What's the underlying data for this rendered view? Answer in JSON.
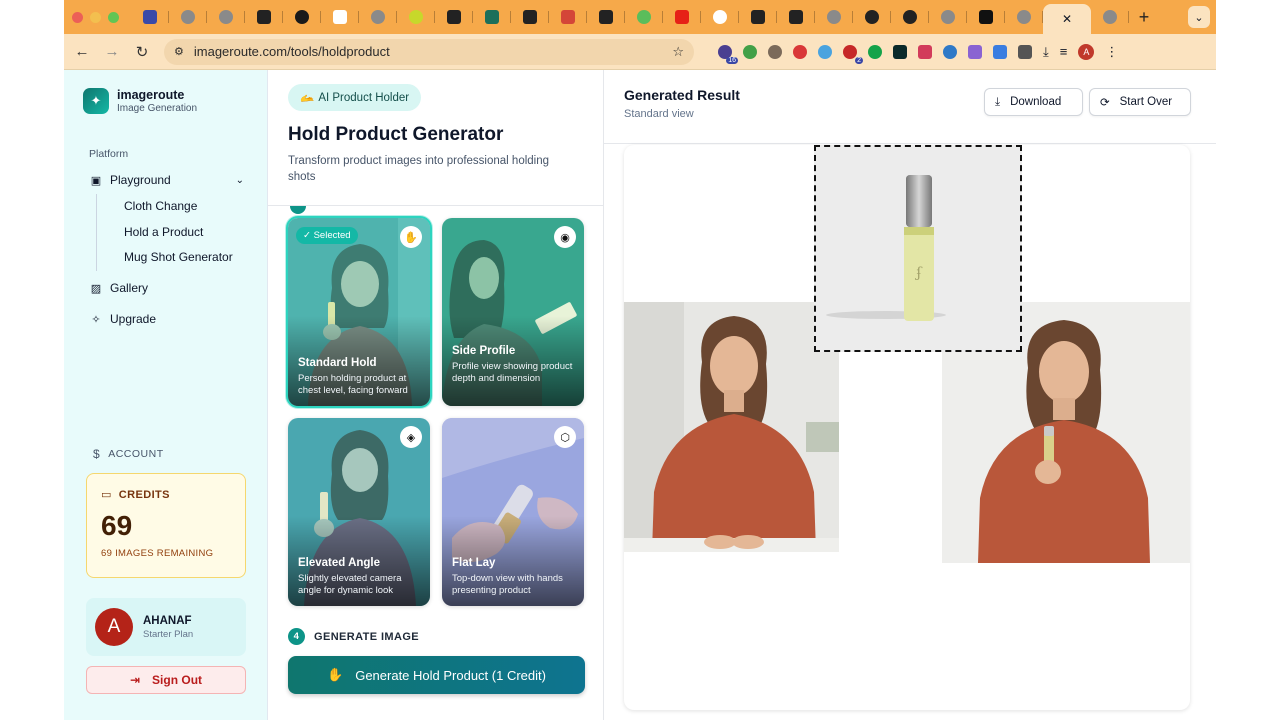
{
  "browser": {
    "url": "imageroute.com/tools/holdproduct",
    "ext_badge_1": "16",
    "ext_badge_2": "2",
    "profile_initial": "A"
  },
  "brand": {
    "name": "imageroute",
    "subtitle": "Image Generation"
  },
  "sidebar": {
    "section_label": "Platform",
    "items": [
      {
        "label": "Playground",
        "icon": "playground-icon"
      },
      {
        "label": "Cloth Change"
      },
      {
        "label": "Hold a Product"
      },
      {
        "label": "Mug Shot Generator"
      },
      {
        "label": "Gallery",
        "icon": "gallery-icon"
      },
      {
        "label": "Upgrade",
        "icon": "sparkle-icon"
      }
    ],
    "account_label": "ACCOUNT",
    "credits": {
      "label": "CREDITS",
      "value": "69",
      "remaining": "69 IMAGES REMAINING"
    },
    "user": {
      "initial": "A",
      "name": "AHANAF",
      "plan": "Starter Plan"
    },
    "signout_label": "Sign Out"
  },
  "tool": {
    "badge": "AI Product Holder",
    "badge_emoji": "🫴",
    "title": "Hold Product Generator",
    "description": "Transform product images into professional holding shots",
    "styles": [
      {
        "title": "Standard Hold",
        "desc": "Person holding product at chest level, facing forward",
        "selected": true,
        "selected_label": "✓ Selected",
        "icon": "hand-icon"
      },
      {
        "title": "Side Profile",
        "desc": "Profile view showing product depth and dimension",
        "icon": "eye-icon"
      },
      {
        "title": "Elevated Angle",
        "desc": "Slightly elevated camera angle for dynamic look",
        "icon": "layers-icon"
      },
      {
        "title": "Flat Lay",
        "desc": "Top-down view with hands presenting product",
        "icon": "box-icon"
      }
    ],
    "step_number": "4",
    "step_label": "GENERATE IMAGE",
    "generate_label": "Generate Hold Product (1 Credit)"
  },
  "result": {
    "title": "Generated Result",
    "subtitle": "Standard view",
    "download_label": "Download",
    "start_over_label": "Start Over"
  },
  "colors": {
    "accent": "#0f766e",
    "tabstrip": "#f6a94a",
    "sidebar_bg": "#e8fbfb",
    "credits_bg": "#fffbe6",
    "signout": "#b91c1c"
  }
}
